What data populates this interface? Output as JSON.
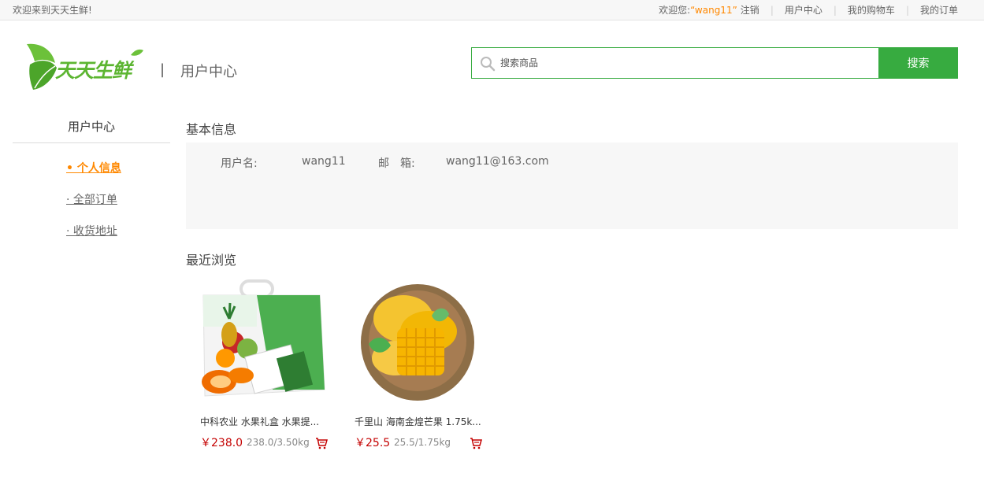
{
  "topbar": {
    "welcome": "欢迎来到天天生鲜!",
    "greeting": "欢迎您:",
    "username": "“wang11”",
    "logout": "注销",
    "user_center": "用户中心",
    "cart": "我的购物车",
    "orders": "我的订单",
    "separator": "|"
  },
  "header": {
    "logo_text": "天天生鲜",
    "divider": "|",
    "title": "用户中心"
  },
  "search": {
    "placeholder": "搜索商品",
    "button": "搜索"
  },
  "sidebar": {
    "title": "用户中心",
    "items": [
      {
        "label": "• 个人信息",
        "active": true
      },
      {
        "label": "· 全部订单",
        "active": false
      },
      {
        "label": "· 收货地址",
        "active": false
      }
    ]
  },
  "basic_info": {
    "title": "基本信息",
    "username_label": "用户名:",
    "username_value": "wang11",
    "email_label": "邮　箱:",
    "email_value": "wang11@163.com"
  },
  "recent": {
    "title": "最近浏览",
    "products": [
      {
        "name": "中科农业 水果礼盒 水果提...",
        "price": "￥238.0",
        "unit": "238.0/3.50kg"
      },
      {
        "name": "千里山 海南金煌芒果 1.75k...",
        "price": "￥25.5",
        "unit": "25.5/1.75kg"
      }
    ]
  },
  "colors": {
    "accent_green": "#37ab40",
    "accent_orange": "#ff8800",
    "price_red": "#c40000"
  }
}
